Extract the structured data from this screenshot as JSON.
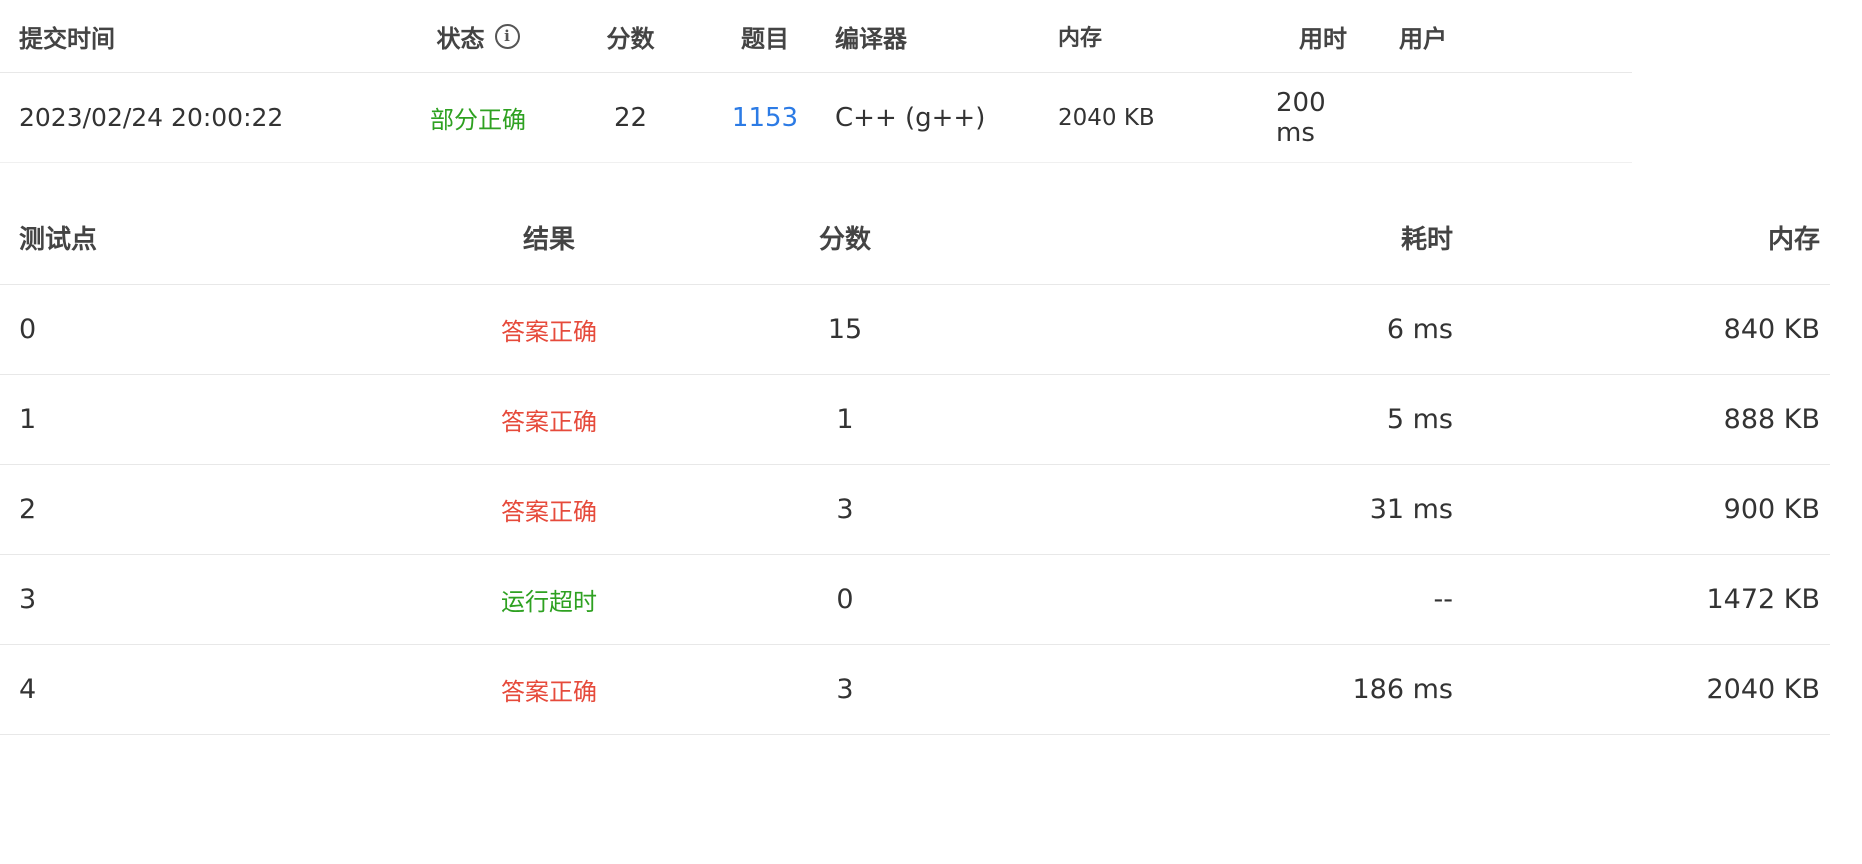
{
  "submission": {
    "headers": {
      "time": "提交时间",
      "status": "状态",
      "score": "分数",
      "problem": "题目",
      "compiler": "编译器",
      "memory": "内存",
      "time_used": "用时",
      "user": "用户"
    },
    "row": {
      "time": "2023/02/24 20:00:22",
      "status": "部分正确",
      "score": "22",
      "problem": "1153",
      "compiler": "C++ (g++)",
      "memory": "2040 KB",
      "time_used": "200 ms",
      "user": ""
    },
    "info_icon": "info-icon"
  },
  "tests": {
    "headers": {
      "id": "测试点",
      "result": "结果",
      "score": "分数",
      "time": "耗时",
      "memory": "内存"
    },
    "rows": [
      {
        "id": "0",
        "result": "答案正确",
        "score": "15",
        "time": "6 ms",
        "memory": "840 KB"
      },
      {
        "id": "1",
        "result": "答案正确",
        "score": "1",
        "time": "5 ms",
        "memory": "888 KB"
      },
      {
        "id": "2",
        "result": "答案正确",
        "score": "3",
        "time": "31 ms",
        "memory": "900 KB"
      },
      {
        "id": "3",
        "result": "运行超时",
        "score": "0",
        "time": "--",
        "memory": "1472 KB"
      },
      {
        "id": "4",
        "result": "答案正确",
        "score": "3",
        "time": "186 ms",
        "memory": "2040 KB"
      }
    ]
  },
  "colors": {
    "accepted": "#e64a3b",
    "partial": "#2ea121",
    "timeout": "#2ea121",
    "link": "#2c7be5"
  }
}
